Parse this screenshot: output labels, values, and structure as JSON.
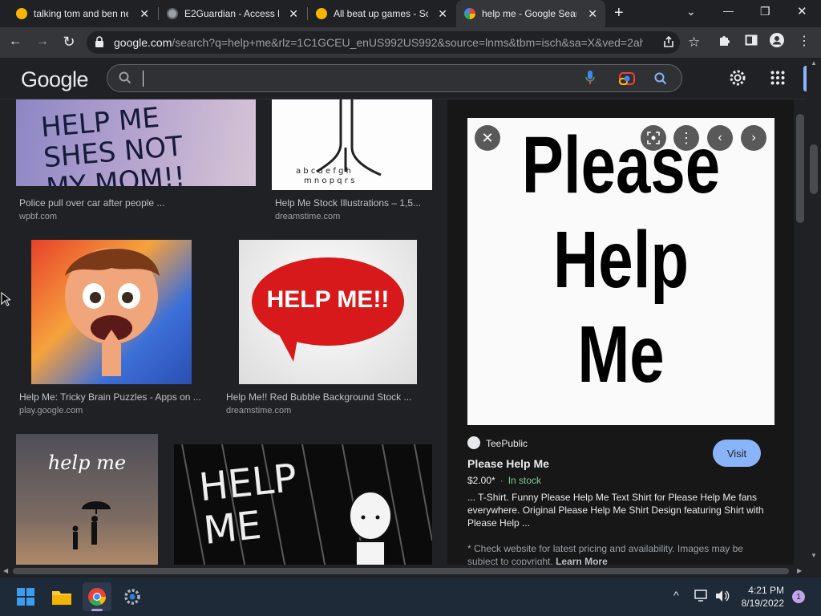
{
  "tabs": [
    {
      "title": "talking tom and ben ne",
      "favicon": "scratch-cat-icon",
      "close": "✕"
    },
    {
      "title": "E2Guardian - Access De",
      "favicon": "globe-icon",
      "close": "✕"
    },
    {
      "title": "All beat up games - Sc",
      "favicon": "scratch-cat-icon",
      "close": "✕"
    },
    {
      "title": "help me - Google Sear",
      "favicon": "google-g-icon",
      "close": "✕"
    }
  ],
  "new_tab": "+",
  "window": {
    "minimize": "—",
    "maximize": "❐",
    "close": "✕",
    "tab_search": "⌄"
  },
  "toolbar": {
    "url_host": "google.com",
    "url_path": "/search?q=help+me&rlz=1C1GCEU_enUS992US992&source=lnms&tbm=isch&sa=X&ved=2ah..."
  },
  "google": {
    "logo": "Google",
    "search_value": ""
  },
  "results": [
    {
      "caption": "Police pull over car after people ...",
      "source": "wpbf.com",
      "image_text": "HELP ME SHES NOT MY MOM!!"
    },
    {
      "caption": "Help Me Stock Illustrations – 1,5...",
      "source": "dreamstime.com"
    },
    {
      "caption": "Help Me: Tricky Brain Puzzles - Apps on ...",
      "source": "play.google.com"
    },
    {
      "caption": "Help Me!! Red Bubble Background Stock ...",
      "source": "dreamstime.com",
      "image_text": "HELP ME!!"
    },
    {
      "caption": "",
      "source": "",
      "image_text": "help me"
    },
    {
      "caption": "",
      "source": "",
      "image_text": "HELP ME"
    }
  ],
  "panel": {
    "preview_lines": [
      "Please",
      "Help",
      "Me"
    ],
    "site": "TeePublic",
    "visit_label": "Visit",
    "title": "Please Help Me",
    "price": "$2.00*",
    "price_sep": "·",
    "stock": "In stock",
    "description": "... T-Shirt. Funny Please Help Me Text Shirt for Please Help Me fans everywhere. Original Please Help Me Shirt Design featuring Shirt with Please Help ...",
    "disclaimer": "* Check website for latest pricing and availability. Images may be subject to copyright.",
    "learn_more": "Learn More"
  },
  "tray": {
    "time": "4:21 PM",
    "date": "8/19/2022",
    "notifications": "1",
    "chevron": "^"
  },
  "colors": {
    "accent_blue": "#8ab4f8",
    "in_stock": "#81c995",
    "dark_bg": "#202124",
    "panel_bg": "#171717"
  }
}
